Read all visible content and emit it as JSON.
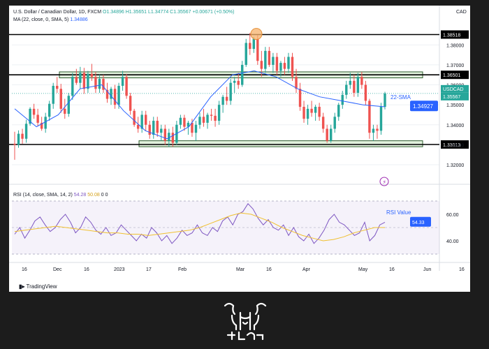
{
  "header": {
    "symbol_line": "U.S. Dollar / Canadian Dollar, 1D, FXCM",
    "ohlc": {
      "o": "O1.34896",
      "h": "H1.35651",
      "l": "L1.34774",
      "c": "C1.35567",
      "chg": "+0.00671 (+0.50%)"
    },
    "ma_line": "MA (22, close, 0, SMA, 5)",
    "ma_value": "1.34886",
    "currency": "CAD"
  },
  "rsi_header": {
    "label": "RSI (14, close, SMA, 14, 2)",
    "rsi_value": "54.28",
    "rsi_ma_value": "50.08",
    "extra": "0 0"
  },
  "branding": {
    "tradingview": "TradingView"
  },
  "colors": {
    "up": "#26a69a",
    "down": "#ef5350",
    "ma": "#2962ff",
    "rsi": "#7e57c2",
    "rsi_ma": "#f0c030",
    "zone": "#c9e3c0"
  },
  "chart_data": [
    {
      "type": "candlestick",
      "title": "U.S. Dollar / Canadian Dollar, 1D, FXCM",
      "ylim": [
        1.313,
        1.392
      ],
      "y_ticks": [
        1.32,
        1.33,
        1.34,
        1.35,
        1.36,
        1.37,
        1.38
      ],
      "y_tick_labels": [
        "1.32000",
        "1.33000",
        "1.34000",
        "1.35000",
        "1.36000",
        "1.37000",
        "1.38000"
      ],
      "x_tick_labels": [
        "16",
        "Dec",
        "16",
        "2023",
        "17",
        "Feb",
        "Mar",
        "16",
        "Apr",
        "May",
        "16",
        "Jun",
        "16"
      ],
      "ohlc": [
        [
          1.3305,
          1.3365,
          1.3225,
          1.33
        ],
        [
          1.33,
          1.3372,
          1.3285,
          1.3355
        ],
        [
          1.3355,
          1.338,
          1.3305,
          1.333
        ],
        [
          1.333,
          1.3425,
          1.331,
          1.3405
        ],
        [
          1.3405,
          1.3488,
          1.3395,
          1.348
        ],
        [
          1.348,
          1.3505,
          1.343,
          1.345
        ],
        [
          1.345,
          1.348,
          1.3395,
          1.341
        ],
        [
          1.341,
          1.344,
          1.337,
          1.338
        ],
        [
          1.338,
          1.346,
          1.336,
          1.344
        ],
        [
          1.344,
          1.352,
          1.342,
          1.3505
        ],
        [
          1.3505,
          1.361,
          1.348,
          1.3595
        ],
        [
          1.3595,
          1.364,
          1.356,
          1.358
        ],
        [
          1.358,
          1.3605,
          1.346,
          1.348
        ],
        [
          1.348,
          1.353,
          1.343,
          1.3455
        ],
        [
          1.3455,
          1.356,
          1.344,
          1.3545
        ],
        [
          1.3545,
          1.366,
          1.3525,
          1.364
        ],
        [
          1.364,
          1.368,
          1.36,
          1.361
        ],
        [
          1.361,
          1.369,
          1.358,
          1.366
        ],
        [
          1.366,
          1.3685,
          1.3555,
          1.358
        ],
        [
          1.358,
          1.367,
          1.356,
          1.3655
        ],
        [
          1.3655,
          1.3705,
          1.362,
          1.364
        ],
        [
          1.364,
          1.3665,
          1.356,
          1.358
        ],
        [
          1.358,
          1.365,
          1.356,
          1.363
        ],
        [
          1.363,
          1.365,
          1.356,
          1.3575
        ],
        [
          1.3575,
          1.361,
          1.351,
          1.353
        ],
        [
          1.353,
          1.359,
          1.35,
          1.358
        ],
        [
          1.358,
          1.36,
          1.348,
          1.35
        ],
        [
          1.35,
          1.361,
          1.348,
          1.3595
        ],
        [
          1.3595,
          1.367,
          1.357,
          1.364
        ],
        [
          1.364,
          1.3655,
          1.353,
          1.3545
        ],
        [
          1.3545,
          1.356,
          1.345,
          1.347
        ],
        [
          1.347,
          1.348,
          1.339,
          1.34
        ],
        [
          1.34,
          1.344,
          1.336,
          1.338
        ],
        [
          1.338,
          1.347,
          1.336,
          1.345
        ],
        [
          1.345,
          1.347,
          1.337,
          1.34
        ],
        [
          1.34,
          1.342,
          1.333,
          1.335
        ],
        [
          1.335,
          1.344,
          1.333,
          1.342
        ],
        [
          1.342,
          1.344,
          1.334,
          1.336
        ],
        [
          1.336,
          1.34,
          1.332,
          1.338
        ],
        [
          1.338,
          1.34,
          1.33,
          1.332
        ],
        [
          1.332,
          1.338,
          1.329,
          1.336
        ],
        [
          1.336,
          1.339,
          1.329,
          1.331
        ],
        [
          1.331,
          1.342,
          1.33,
          1.34
        ],
        [
          1.34,
          1.345,
          1.338,
          1.3435
        ],
        [
          1.3435,
          1.345,
          1.337,
          1.339
        ],
        [
          1.339,
          1.342,
          1.335,
          1.341
        ],
        [
          1.341,
          1.343,
          1.334,
          1.336
        ],
        [
          1.336,
          1.342,
          1.332,
          1.34
        ],
        [
          1.34,
          1.346,
          1.338,
          1.344
        ],
        [
          1.344,
          1.348,
          1.339,
          1.341
        ],
        [
          1.341,
          1.346,
          1.338,
          1.345
        ],
        [
          1.345,
          1.348,
          1.342,
          1.3445
        ],
        [
          1.3445,
          1.348,
          1.339,
          1.342
        ],
        [
          1.342,
          1.352,
          1.34,
          1.35
        ],
        [
          1.35,
          1.355,
          1.346,
          1.354
        ],
        [
          1.354,
          1.359,
          1.35,
          1.352
        ],
        [
          1.352,
          1.363,
          1.35,
          1.361
        ],
        [
          1.361,
          1.364,
          1.356,
          1.362
        ],
        [
          1.362,
          1.366,
          1.358,
          1.36
        ],
        [
          1.36,
          1.372,
          1.359,
          1.37
        ],
        [
          1.37,
          1.383,
          1.369,
          1.381
        ],
        [
          1.381,
          1.386,
          1.375,
          1.378
        ],
        [
          1.378,
          1.384,
          1.376,
          1.383
        ],
        [
          1.383,
          1.385,
          1.37,
          1.372
        ],
        [
          1.372,
          1.377,
          1.364,
          1.368
        ],
        [
          1.368,
          1.379,
          1.366,
          1.377
        ],
        [
          1.377,
          1.379,
          1.369,
          1.37
        ],
        [
          1.37,
          1.376,
          1.366,
          1.374
        ],
        [
          1.374,
          1.376,
          1.365,
          1.367
        ],
        [
          1.367,
          1.372,
          1.364,
          1.371
        ],
        [
          1.371,
          1.374,
          1.365,
          1.368
        ],
        [
          1.368,
          1.376,
          1.366,
          1.374
        ],
        [
          1.374,
          1.376,
          1.362,
          1.364
        ],
        [
          1.364,
          1.368,
          1.356,
          1.358
        ],
        [
          1.358,
          1.361,
          1.347,
          1.349
        ],
        [
          1.349,
          1.352,
          1.341,
          1.343
        ],
        [
          1.343,
          1.35,
          1.34,
          1.348
        ],
        [
          1.348,
          1.352,
          1.344,
          1.346
        ],
        [
          1.346,
          1.35,
          1.342,
          1.349
        ],
        [
          1.349,
          1.351,
          1.342,
          1.344
        ],
        [
          1.344,
          1.346,
          1.336,
          1.338
        ],
        [
          1.338,
          1.34,
          1.331,
          1.332
        ],
        [
          1.332,
          1.34,
          1.331,
          1.338
        ],
        [
          1.338,
          1.346,
          1.336,
          1.344
        ],
        [
          1.344,
          1.351,
          1.342,
          1.35
        ],
        [
          1.35,
          1.357,
          1.348,
          1.355
        ],
        [
          1.355,
          1.362,
          1.353,
          1.36
        ],
        [
          1.36,
          1.366,
          1.358,
          1.362
        ],
        [
          1.362,
          1.365,
          1.354,
          1.356
        ],
        [
          1.356,
          1.366,
          1.354,
          1.364
        ],
        [
          1.364,
          1.3665,
          1.358,
          1.36
        ],
        [
          1.36,
          1.362,
          1.35,
          1.352
        ],
        [
          1.352,
          1.353,
          1.333,
          1.336
        ],
        [
          1.336,
          1.34,
          1.332,
          1.338
        ],
        [
          1.338,
          1.34,
          1.333,
          1.337
        ],
        [
          1.337,
          1.351,
          1.335,
          1.349
        ],
        [
          1.349,
          1.3565,
          1.3477,
          1.3557
        ]
      ],
      "ma": {
        "name": "22-SMA",
        "values_approx": [
          1.348,
          1.339,
          1.345,
          1.358,
          1.36,
          1.347,
          1.337,
          1.333,
          1.339,
          1.354,
          1.365,
          1.367,
          1.364,
          1.358,
          1.354,
          1.352,
          1.35,
          1.349
        ],
        "last": "1.34927"
      },
      "levels": [
        {
          "value": 1.38518,
          "label": "1.38518"
        },
        {
          "value": 1.36501,
          "label": "1.36501"
        },
        {
          "value": 1.33013,
          "label": "1.33013"
        }
      ],
      "zones": [
        {
          "from": 1.3635,
          "to": 1.3665
        },
        {
          "from": 1.329,
          "to": 1.332
        }
      ],
      "last_price_label": "1.35567",
      "last_symbol_label": "USDCAD",
      "ma_annotation": "22-SMA"
    },
    {
      "type": "line",
      "title": "RSI (14, close, SMA, 14, 2)",
      "ylim": [
        30,
        70
      ],
      "y_ticks": [
        40,
        60
      ],
      "y_tick_labels": [
        "40.00",
        "60.00"
      ],
      "band": [
        30,
        70
      ],
      "rsi_series": [
        45,
        50,
        42,
        48,
        55,
        58,
        52,
        47,
        50,
        56,
        60,
        54,
        46,
        50,
        58,
        54,
        48,
        45,
        50,
        44,
        46,
        52,
        48,
        44,
        40,
        45,
        42,
        50,
        46,
        40,
        44,
        38,
        42,
        48,
        44,
        46,
        52,
        46,
        44,
        50,
        47,
        55,
        58,
        52,
        60,
        62,
        68,
        64,
        57,
        52,
        56,
        50,
        48,
        52,
        44,
        50,
        43,
        40,
        45,
        38,
        42,
        48,
        56,
        60,
        54,
        52,
        48,
        44,
        46,
        54,
        40,
        44,
        52,
        54
      ],
      "rsi_ma_series": [
        47,
        48,
        49,
        50,
        51,
        50,
        49,
        48,
        47,
        46,
        46,
        45,
        45,
        44,
        45,
        46,
        47,
        48,
        50,
        53,
        56,
        59,
        61,
        60,
        57,
        54,
        50,
        47,
        44,
        42,
        40,
        41,
        43,
        46,
        48,
        50,
        50
      ],
      "annotation": "RSI Value",
      "current_value": "54.33"
    }
  ]
}
